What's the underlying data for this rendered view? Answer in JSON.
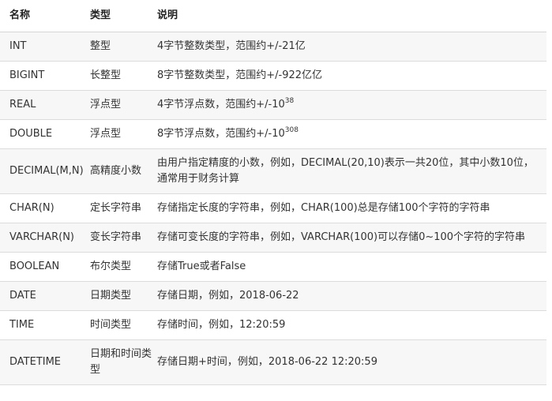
{
  "headers": [
    "名称",
    "类型",
    "说明"
  ],
  "rows": [
    {
      "name": "INT",
      "type": "整型",
      "desc": "4字节整数类型，范围约+/-21亿",
      "sup": ""
    },
    {
      "name": "BIGINT",
      "type": "长整型",
      "desc": "8字节整数类型，范围约+/-922亿亿",
      "sup": ""
    },
    {
      "name": "REAL",
      "type": "浮点型",
      "desc": "4字节浮点数，范围约+/-10",
      "sup": "38"
    },
    {
      "name": "DOUBLE",
      "type": "浮点型",
      "desc": "8字节浮点数，范围约+/-10",
      "sup": "308"
    },
    {
      "name": "DECIMAL(M,N)",
      "type": "高精度小数",
      "desc": "由用户指定精度的小数，例如，DECIMAL(20,10)表示一共20位，其中小数10位，通常用于财务计算",
      "sup": ""
    },
    {
      "name": "CHAR(N)",
      "type": "定长字符串",
      "desc": "存储指定长度的字符串，例如，CHAR(100)总是存储100个字符的字符串",
      "sup": ""
    },
    {
      "name": "VARCHAR(N)",
      "type": "变长字符串",
      "desc": "存储可变长度的字符串，例如，VARCHAR(100)可以存储0~100个字符的字符串",
      "sup": ""
    },
    {
      "name": "BOOLEAN",
      "type": "布尔类型",
      "desc": "存储True或者False",
      "sup": ""
    },
    {
      "name": "DATE",
      "type": "日期类型",
      "desc": "存储日期，例如，2018-06-22",
      "sup": ""
    },
    {
      "name": "TIME",
      "type": "时间类型",
      "desc": "存储时间，例如，12:20:59",
      "sup": ""
    },
    {
      "name": "DATETIME",
      "type": "日期和时间类型",
      "desc": "存储日期+时间，例如，2018-06-22 12:20:59",
      "sup": ""
    }
  ]
}
